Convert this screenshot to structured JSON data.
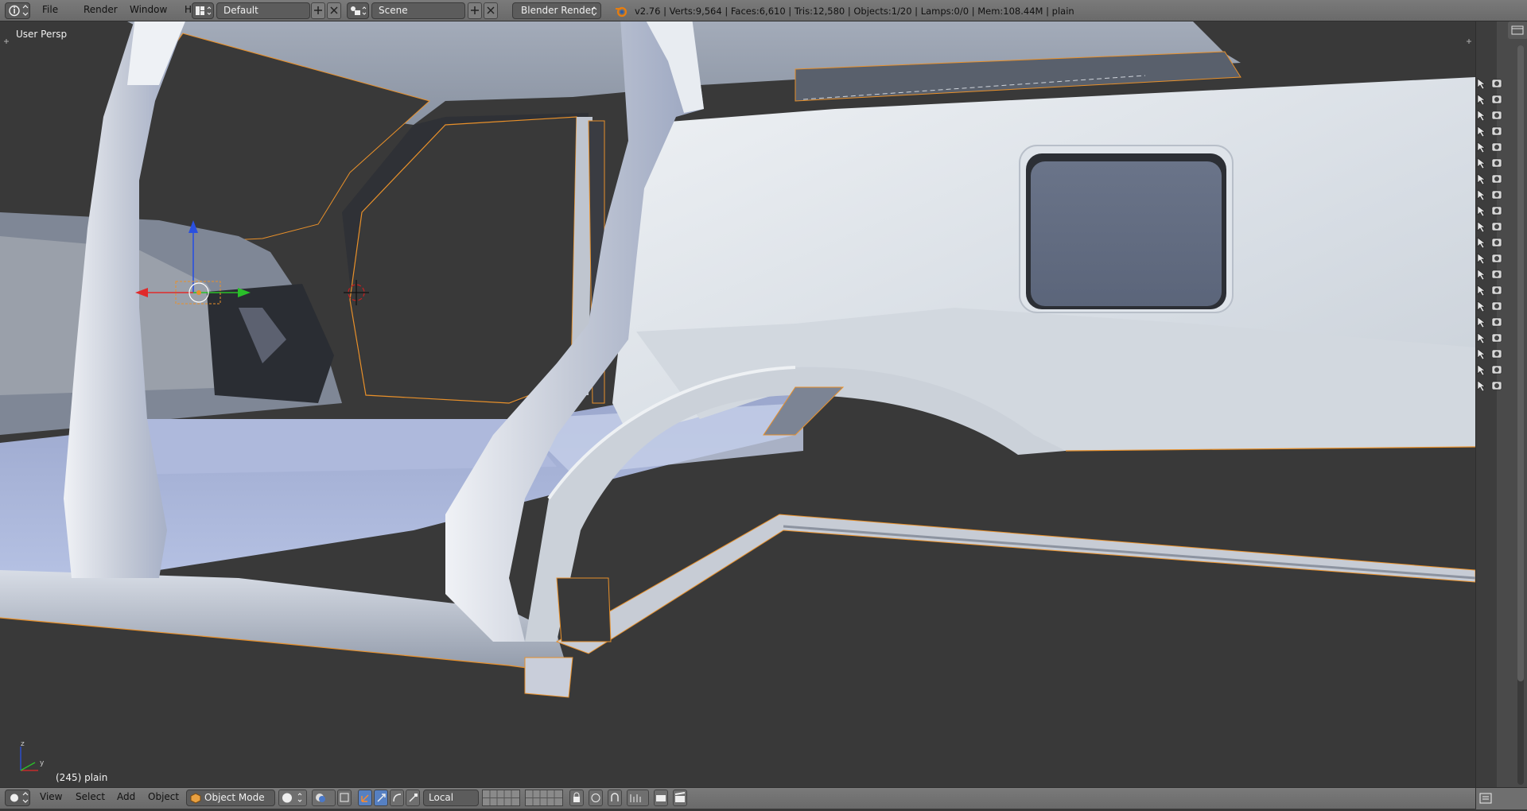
{
  "topbar": {
    "menus": [
      "File",
      "Render",
      "Window",
      "Help"
    ],
    "screen_layout": "Default",
    "scene": "Scene",
    "render_engine": "Blender Render",
    "stats": "v2.76 | Verts:9,564 | Faces:6,610 | Tris:12,580 | Objects:1/20 | Lamps:0/0 | Mem:108.44M | plain"
  },
  "viewport": {
    "view_name": "User Persp",
    "frame_object": "(245) plain",
    "axis_labels": {
      "z": "z",
      "y": "y"
    }
  },
  "bottombar": {
    "menus": [
      "View",
      "Select",
      "Add",
      "Object"
    ],
    "mode": "Object Mode",
    "pivot": "Local"
  },
  "colors": {
    "header_bg": "#737373",
    "viewport_bg": "#393939",
    "selection_outline": "#e8902a",
    "mesh_light": "#dfe4ea",
    "mesh_blue": "#a9b6dd"
  },
  "icons": {
    "editor_type": "info-icon",
    "screen_layout": "screen-layout-icon",
    "scene": "scene-icon",
    "blender_logo": "blender-logo-icon",
    "viewport_editor": "view3d-icon",
    "mode_icon": "object-mode-icon"
  }
}
